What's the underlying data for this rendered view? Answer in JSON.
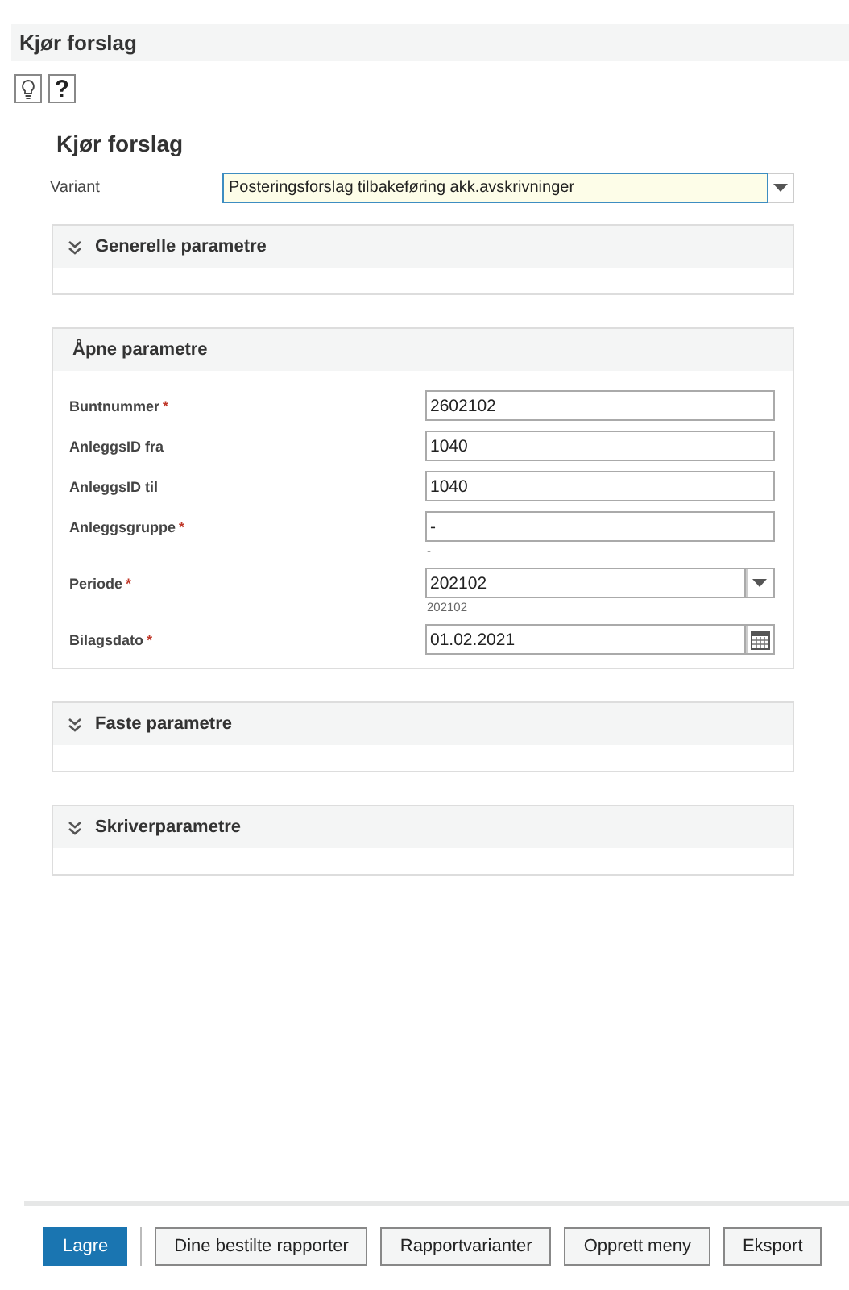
{
  "window": {
    "title": "Kjør forslag"
  },
  "toolbar": [
    {
      "kind": "bulb"
    },
    {
      "kind": "help",
      "label": "?"
    }
  ],
  "heading": "Kjør forslag",
  "variant": {
    "label": "Variant",
    "value": "Posteringsforslag tilbakeføring akk.avskrivninger",
    "focused": true
  },
  "sections": [
    {
      "title": "Generelle parametre",
      "collapsible": true
    },
    {
      "title": "Åpne parametre",
      "collapsible": false,
      "fields": [
        {
          "label": "Buntnummer",
          "required_mark": "*",
          "kind": "text",
          "value": "2602102"
        },
        {
          "label": "AnleggsID fra",
          "kind": "text",
          "value": "1040"
        },
        {
          "label": "AnleggsID til",
          "kind": "text",
          "value": "1040"
        },
        {
          "label": "Anleggsgruppe",
          "required_mark": "*",
          "kind": "text",
          "value": "-",
          "hint": "-"
        },
        {
          "label": "Periode",
          "required_mark": "*",
          "kind": "select",
          "value": "202102",
          "hint": "202102"
        },
        {
          "label": "Bilagsdato",
          "required_mark": "*",
          "kind": "date",
          "value": "01.02.2021"
        }
      ]
    },
    {
      "title": "Faste parametre",
      "collapsible": true
    },
    {
      "title": "Skriverparametre",
      "collapsible": true
    }
  ],
  "buttons": [
    {
      "label": "Lagre",
      "primary": true
    },
    {
      "label": "Dine bestilte rapporter",
      "primary": false
    },
    {
      "label": "Rapportvarianter",
      "primary": false
    },
    {
      "label": "Opprett meny",
      "primary": false
    },
    {
      "label": "Eksport",
      "primary": false
    }
  ]
}
